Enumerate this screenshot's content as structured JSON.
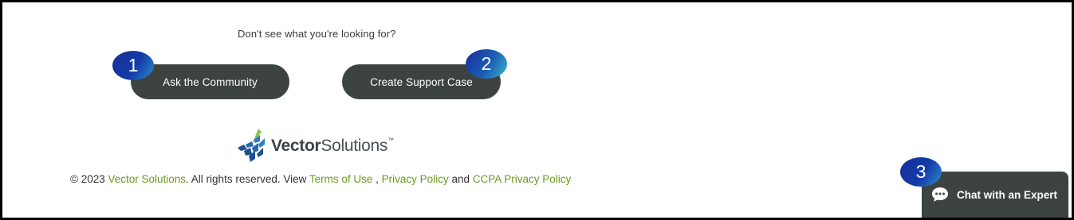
{
  "help": {
    "prompt": "Don't see what you're looking for?",
    "ask_community_label": "Ask the Community",
    "create_case_label": "Create Support Case"
  },
  "badges": {
    "one": "1",
    "two": "2",
    "three": "3"
  },
  "logo": {
    "brand_bold": "Vector",
    "brand_light": "Solutions",
    "trademark": "™",
    "icon": "vector-solutions-logo-icon"
  },
  "footer": {
    "copyright_prefix": "© 2023 ",
    "company_link": "Vector Solutions",
    "rights_text": ". All rights reserved. View ",
    "terms_link": "Terms of Use",
    "separator": " , ",
    "privacy_link": "Privacy Policy",
    "and_text": " and ",
    "ccpa_link": "CCPA Privacy Policy"
  },
  "chat": {
    "label": "Chat with an Expert",
    "icon": "chat-bubble-icon"
  },
  "colors": {
    "button_bg": "#3c4341",
    "link_green": "#6a9a1f",
    "badge_blue": "#123ba8"
  }
}
